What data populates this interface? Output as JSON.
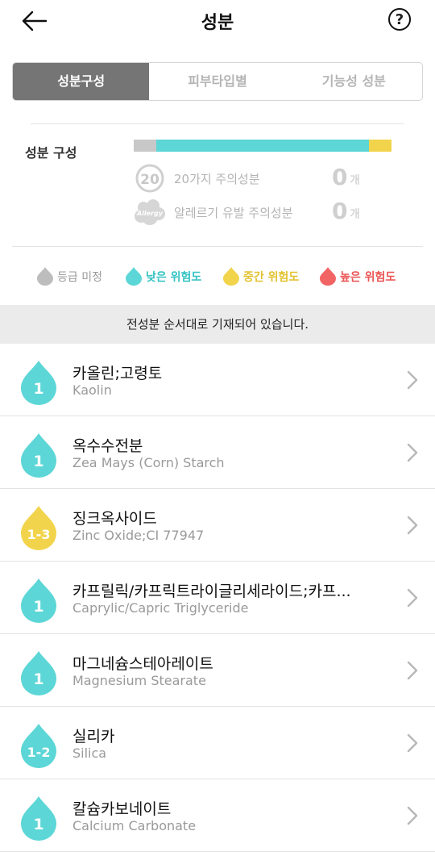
{
  "header": {
    "title": "성분",
    "help_label": "?"
  },
  "tabs": [
    {
      "label": "성분구성",
      "active": true
    },
    {
      "label": "피부타입별",
      "active": false
    },
    {
      "label": "기능성 성분",
      "active": false
    }
  ],
  "composition": {
    "label": "성분 구성",
    "distribution": {
      "unrated": 1,
      "low": 6,
      "medium": 1,
      "high": 0
    },
    "warnings": [
      {
        "icon": "caution-20-icon",
        "badge": "20",
        "label": "20가지 주의성분",
        "count": "0",
        "unit": "개"
      },
      {
        "icon": "allergy-icon",
        "badge": "Allergy",
        "label": "알레르기 유발 주의성분",
        "count": "0",
        "unit": "개"
      }
    ]
  },
  "legend": [
    {
      "label": "등급 미정",
      "color": "#bdbdbd",
      "text_color": "#9a9a9a"
    },
    {
      "label": "낮은 위험도",
      "color": "#5cd6d6",
      "text_color": "#34c3c3"
    },
    {
      "label": "중간 위험도",
      "color": "#f2d44c",
      "text_color": "#e3c22f"
    },
    {
      "label": "높은 위험도",
      "color": "#f26464",
      "text_color": "#ec5454"
    }
  ],
  "notice": "전성분 순서대로 기재되어 있습니다.",
  "ingredients": [
    {
      "grade": "1",
      "level": "low",
      "name": "카올린;고령토",
      "english": "Kaolin"
    },
    {
      "grade": "1",
      "level": "low",
      "name": "옥수수전분",
      "english": "Zea Mays (Corn) Starch"
    },
    {
      "grade": "1-3",
      "level": "medium",
      "name": "징크옥사이드",
      "english": "Zinc Oxide;CI 77947"
    },
    {
      "grade": "1",
      "level": "low",
      "name": "카프릴릭/카프릭트라이글리세라이드;카프...",
      "english": "Caprylic/Capric Triglyceride"
    },
    {
      "grade": "1",
      "level": "low",
      "name": "마그네슘스테아레이트",
      "english": "Magnesium Stearate"
    },
    {
      "grade": "1-2",
      "level": "low",
      "name": "실리카",
      "english": "Silica"
    },
    {
      "grade": "1",
      "level": "low",
      "name": "칼슘카보네이트",
      "english": "Calcium Carbonate"
    }
  ],
  "colors": {
    "low": "#5cd6d6",
    "medium": "#f2d44c",
    "high": "#f26464",
    "unrated": "#c8c8c8",
    "tab_active": "#757575"
  }
}
